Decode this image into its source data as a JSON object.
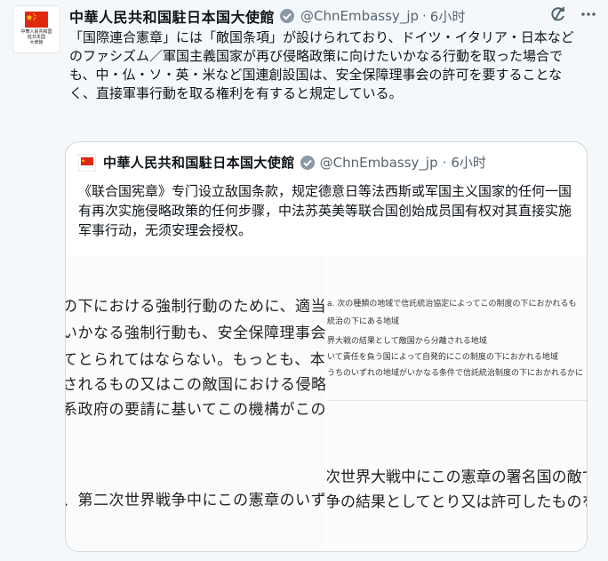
{
  "tweet": {
    "avatar_caption": "中華人民共和国\n駐日本国\n大使館",
    "author_name": "中華人民共和国駐日本国大使館",
    "handle": "@ChnEmbassy_jp",
    "dot": "·",
    "time": "6小时",
    "icons": {
      "verified": "verified-badge-icon",
      "refresh": "refresh-icon",
      "more": "more-icon",
      "flag": "china-flag-icon"
    },
    "text": "「国際連合憲章」には「敵国条項」が設けられており、ドイツ・イタリア・日本などのファシズム／軍国主義国家が再び侵略政策に向けたいかなる行動を取った場合でも、中・仏・ソ・英・米など国連創設国は、安全保障理事会の許可を要することなく、直接軍事行動を取る権利を有すると規定している。"
  },
  "quote": {
    "author_name": "中華人民共和国駐日本国大使館",
    "handle": "@ChnEmbassy_jp",
    "dot": "·",
    "time": "6小时",
    "text": "《联合国宪章》专门设立敌国条款，规定德意日等法西斯或军国主义国家的任何一国有再次实施侵略政策的任何步骤，中法苏英美等联合国创始成员国有权对其直接实施军事行动，无须安理会授权。",
    "image_left_lines": [
      "の下における強制行動のために、適当な",
      "いかなる強制行動も、安全保障理事会",
      "てとられてはならない。もっとも、本条",
      "されるもの又はこの敵国における侵略",
      "系政府の要請に基いてこの機構がこの敵",
      "、第二次世界戦争中にこの憲章のいず"
    ],
    "image_right_small": [
      "a. 次の種類の地域で信託統治協定によってこの制度の下におかれるも",
      "統治の下にある地域",
      "界大戦の結果として敵国から分離される地域",
      "いて責任を負う国によって自発的にこの制度の下におかれる地域",
      "うちのいずれの地域がいかなる条件で信託統治制度の下におかれるかに"
    ],
    "image_right_big": [
      "次世界大戦中にこの憲章の署名国の敵であ",
      "争の結果としてとり又は許可したものを無"
    ]
  }
}
